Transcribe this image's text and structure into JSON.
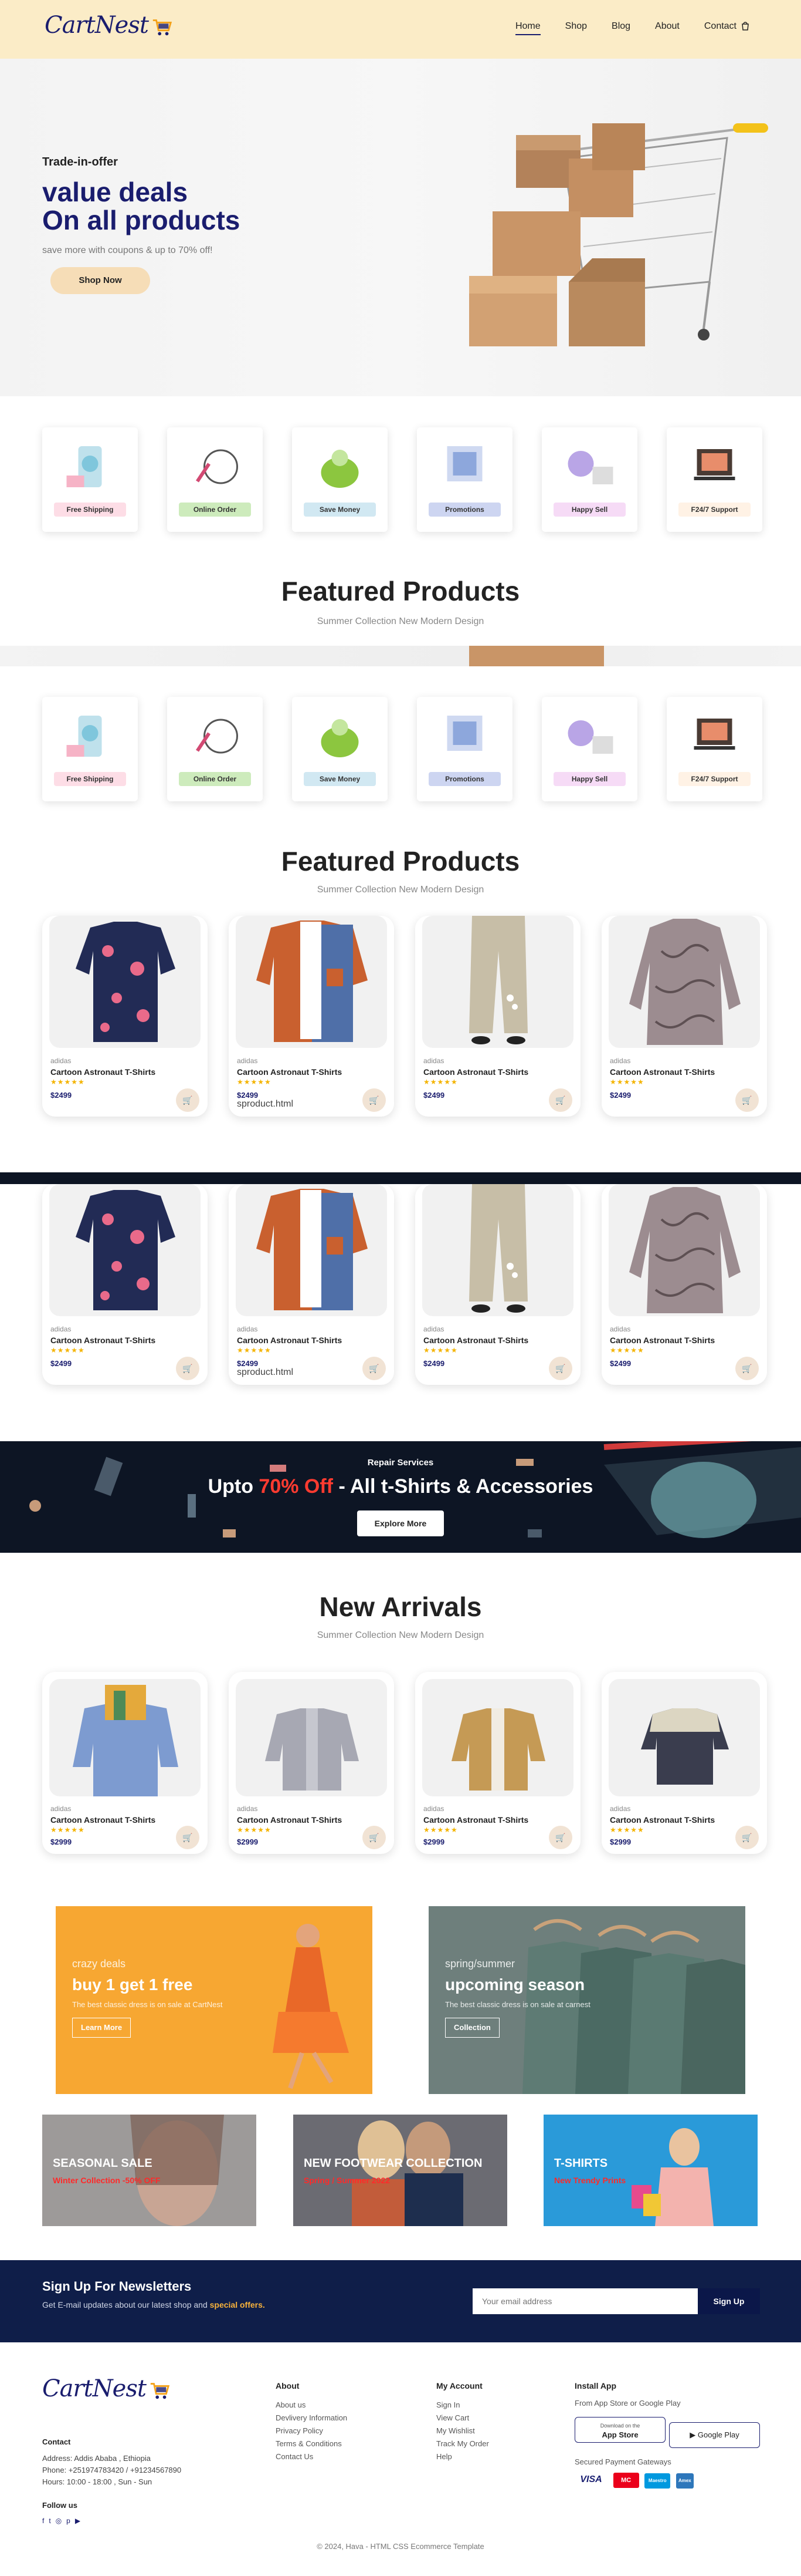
{
  "header": {
    "logo": "CartNest",
    "nav": [
      "Home",
      "Shop",
      "Blog",
      "About",
      "Contact"
    ],
    "cart_icon": "bag-icon"
  },
  "hero": {
    "kicker": "Trade-in-offer",
    "line1": "value deals",
    "line2": "On all products",
    "sub": "save more with coupons & up to 70% off!",
    "button": "Shop Now"
  },
  "features": [
    {
      "label": "Free Shipping",
      "color": "#fddde6"
    },
    {
      "label": "Online Order",
      "color": "#cdebbc"
    },
    {
      "label": "Save Money",
      "color": "#d1e8f2"
    },
    {
      "label": "Promotions",
      "color": "#cdd5f1"
    },
    {
      "label": "Happy Sell",
      "color": "#f6dbf6"
    },
    {
      "label": "F24/7 Support",
      "color": "#fff2e5"
    }
  ],
  "featured": {
    "title": "Featured Products",
    "sub": "Summer Collection New Modern Design"
  },
  "products": [
    {
      "brand": "adidas",
      "name": "Cartoon Astronaut T-Shirts",
      "stars": "★★★★★",
      "price": "$2499",
      "extra": ""
    },
    {
      "brand": "adidas",
      "name": "Cartoon Astronaut T-Shirts",
      "stars": "★★★★★",
      "price": "$2499",
      "extra": "sproduct.html"
    },
    {
      "brand": "adidas",
      "name": "Cartoon Astronaut T-Shirts",
      "stars": "★★★★★",
      "price": "$2499",
      "extra": ""
    },
    {
      "brand": "adidas",
      "name": "Cartoon Astronaut T-Shirts",
      "stars": "★★★★★",
      "price": "$2499",
      "extra": ""
    }
  ],
  "promo": {
    "small": "Repair Services",
    "big_pre": "Upto ",
    "big_hl": "70% Off",
    "big_post": " - All t-Shirts & Accessories",
    "button": "Explore More"
  },
  "new_arrivals": {
    "title": "New Arrivals",
    "sub": "Summer Collection New Modern Design",
    "items": [
      {
        "brand": "adidas",
        "name": "Cartoon Astronaut T-Shirts",
        "stars": "★★★★★",
        "price": "$2999"
      },
      {
        "brand": "adidas",
        "name": "Cartoon Astronaut T-Shirts",
        "stars": "★★★★★",
        "price": "$2999"
      },
      {
        "brand": "adidas",
        "name": "Cartoon Astronaut T-Shirts",
        "stars": "★★★★★",
        "price": "$2999"
      },
      {
        "brand": "adidas",
        "name": "Cartoon Astronaut T-Shirts",
        "stars": "★★★★★",
        "price": "$2999"
      }
    ]
  },
  "banners": {
    "left": {
      "kicker": "crazy deals",
      "title": "buy 1 get 1 free",
      "sub": "The best classic dress is on sale at CartNest",
      "button": "Learn More"
    },
    "right": {
      "kicker": "spring/summer",
      "title": "upcoming season",
      "sub": "The best classic dress is on sale at carnest",
      "button": "Collection"
    },
    "small": [
      {
        "title": "SEASONAL SALE",
        "sub": "Winter Collection -50% OFF"
      },
      {
        "title": "NEW FOOTWEAR COLLECTION",
        "sub": "Spring / Summer 2022"
      },
      {
        "title": "T-SHIRTS",
        "sub": "New Trendy Prints"
      }
    ]
  },
  "newsletter": {
    "title": "Sign Up For Newsletters",
    "sub_pre": "Get E-mail updates about our latest shop and ",
    "sub_hl": "special offers.",
    "placeholder": "Your email address",
    "button": "Sign Up"
  },
  "footer": {
    "contact_title": "Contact",
    "address": "Address: Addis Ababa , Ethiopia",
    "phone": "Phone: +251974783420 / +91234567890",
    "hours": "Hours: 10:00 - 18:00 , Sun - Sun",
    "follow": "Follow us",
    "about_title": "About",
    "about": [
      "About us",
      "Devlivery Information",
      "Privacy Policy",
      "Terms & Conditions",
      "Contact Us"
    ],
    "account_title": "My Account",
    "account": [
      "Sign In",
      "View Cart",
      "My Wishlist",
      "Track My Order",
      "Help"
    ],
    "install_title": "Install App",
    "install_sub": "From App Store or Google Play",
    "app_store": "App Store",
    "app_store_small": "Download on the",
    "google_play": "Google Play",
    "secured": "Secured Payment Gateways",
    "payments": [
      "VISA",
      "MC",
      "Maestro",
      "Amex"
    ],
    "copyright": "© 2024, Hava - HTML CSS Ecommerce Template"
  }
}
